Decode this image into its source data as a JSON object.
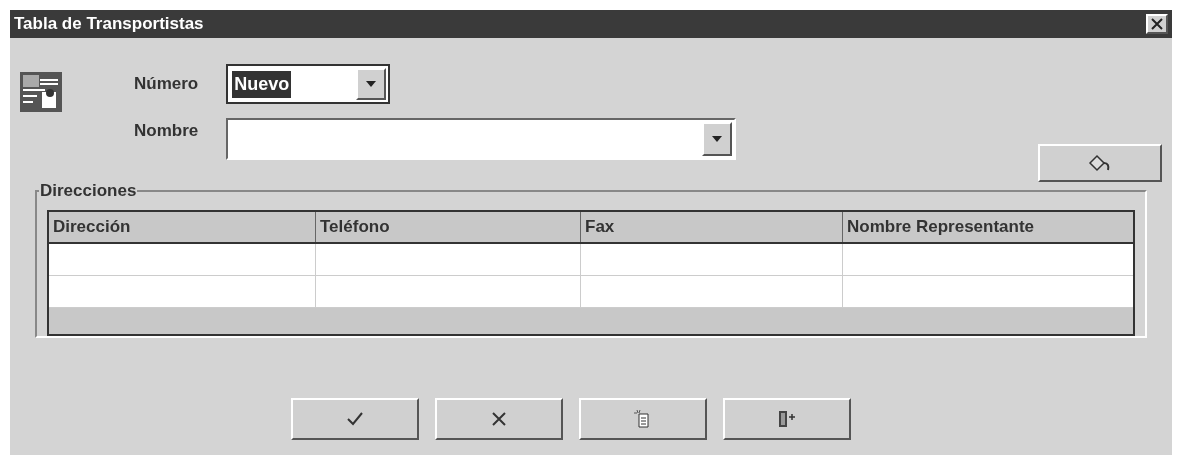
{
  "window": {
    "title": "Tabla de Transportistas"
  },
  "form": {
    "numero": {
      "label": "Número",
      "value": "Nuevo",
      "value_selected": true
    },
    "nombre": {
      "label": "Nombre"
    }
  },
  "group": {
    "title": "Direcciones",
    "table": {
      "columns": [
        "Dirección",
        "Teléfono",
        "Fax",
        "Nombre Representante"
      ]
    }
  },
  "buttons": [
    {
      "kind": "accept"
    },
    {
      "kind": "cancel"
    },
    {
      "kind": "new"
    },
    {
      "kind": "exit"
    }
  ]
}
